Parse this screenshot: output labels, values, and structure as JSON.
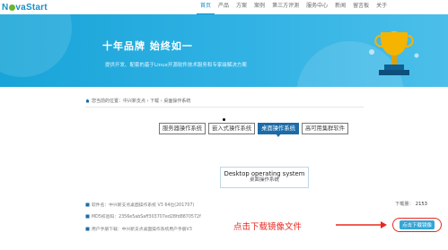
{
  "nav": {
    "logo_text": {
      "pre": "N",
      "post": "vaStart"
    },
    "items": [
      {
        "label": "首页",
        "active": true
      },
      {
        "label": "产品",
        "active": false
      },
      {
        "label": "方案",
        "active": false
      },
      {
        "label": "案例",
        "active": false
      },
      {
        "label": "第三方评测",
        "active": false
      },
      {
        "label": "服务中心",
        "active": false
      },
      {
        "label": "新闻",
        "active": false
      },
      {
        "label": "留言板",
        "active": false
      },
      {
        "label": "关于",
        "active": false
      }
    ]
  },
  "banner": {
    "title": "十年品牌  始终如一",
    "subtitle": "提供开发、配套的基于Linux开源软件技术服务和专家级解决方案"
  },
  "breadcrumb": "您当前的位置：中兴新支点 › 下载 › 桌面操作系统",
  "tabs": [
    {
      "label": "服务器操作系统",
      "active": false
    },
    {
      "label": "嵌入式操作系统",
      "active": false
    },
    {
      "label": "桌面操作系统",
      "active": true
    },
    {
      "label": "高可用集群软件",
      "active": false
    }
  ],
  "platform": {
    "title": "Desktop operating system",
    "subtitle": "桌面操作系统"
  },
  "file_info": {
    "software": "软件名：中兴新支点桌面操作系统 V3 64位(201707)",
    "md5": "MD5校验码：2356e5abSaff303707ed28fd8870572f",
    "manual": "用户手册下载：中兴新支点桌面操作系统用户手册V3",
    "download_count_label": "下载量：",
    "download_count": "2153"
  },
  "annotation": "点击下载镜像文件",
  "download_button": "点击下载镜像",
  "colors": {
    "primary": "#1a8fc8",
    "active_tab": "#1b6ca8",
    "annotation": "#e8281f",
    "button": "#35a6d6"
  }
}
